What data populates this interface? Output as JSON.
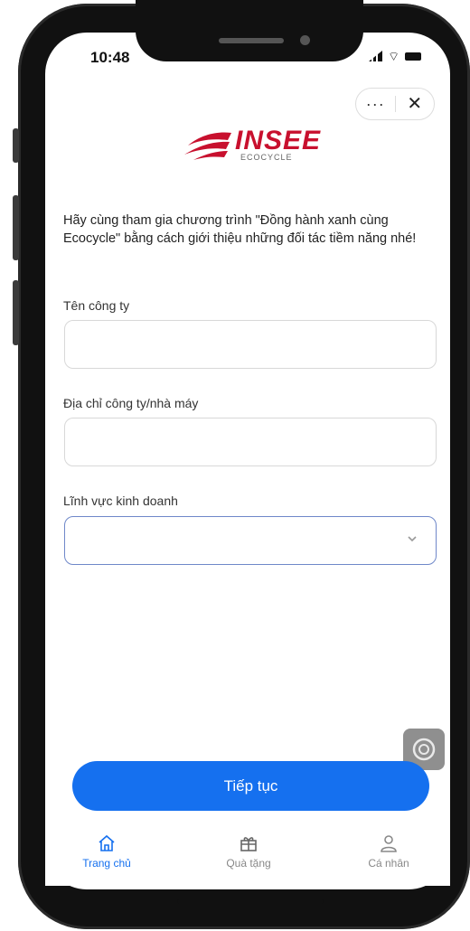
{
  "status_bar": {
    "time": "10:48"
  },
  "mini_program_capsule": {
    "more_label": "···",
    "close_label": "✕"
  },
  "logo": {
    "brand": "INSEE",
    "sub": "ECOCYCLE"
  },
  "intro_text": "Hãy cùng tham gia chương trình \"Đồng hành xanh cùng Ecocycle\" bằng cách giới thiệu những đối tác tiềm năng nhé!",
  "form": {
    "company_name": {
      "label": "Tên công ty",
      "value": ""
    },
    "company_address": {
      "label": "Địa chỉ công ty/nhà máy",
      "value": ""
    },
    "business_field": {
      "label": "Lĩnh vực kinh doanh",
      "value": ""
    }
  },
  "continue_button": {
    "label": "Tiếp tục"
  },
  "tabbar": {
    "items": [
      {
        "label": "Trang chủ",
        "icon": "home-icon",
        "active": true
      },
      {
        "label": "Quà tặng",
        "icon": "gift-icon",
        "active": false
      },
      {
        "label": "Cá nhân",
        "icon": "user-icon",
        "active": false
      }
    ]
  },
  "colors": {
    "primary": "#1570ef",
    "brand_red": "#c8102e"
  }
}
